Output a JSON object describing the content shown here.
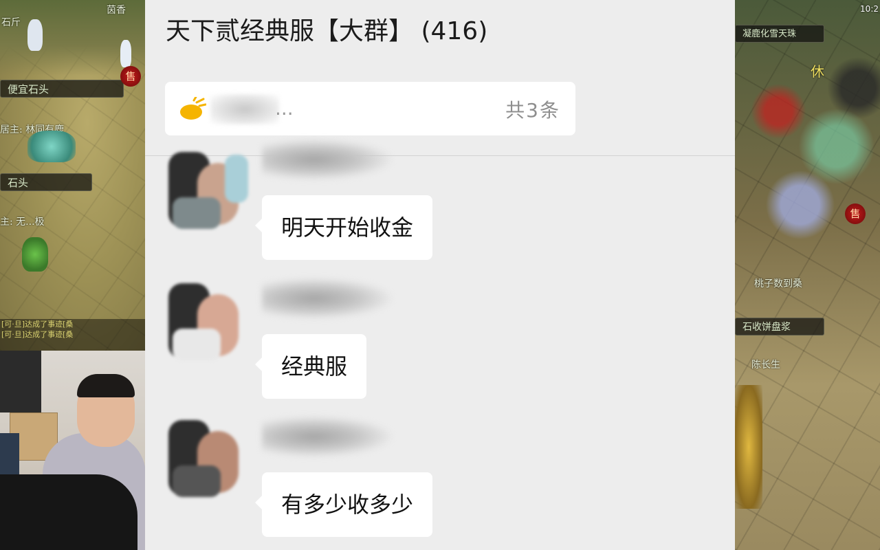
{
  "chat": {
    "title": "天下贰经典服【大群】 (416)",
    "notice": {
      "icon": "megaphone-icon",
      "text": "...",
      "count": "共3条"
    },
    "messages": [
      {
        "text": "明天开始收金"
      },
      {
        "text": "经典服"
      },
      {
        "text": "有多少收多少"
      }
    ]
  },
  "game_left": {
    "labels": [
      "茵香",
      "石斤",
      "便宜石头",
      "居主: 林同有鹿",
      "石头",
      "主: 无...极"
    ],
    "sell_badge": "售",
    "chat_lines": [
      "[可·旦]达成了事迹[桑",
      "[可·旦]达成了事迹[桑"
    ]
  },
  "game_right": {
    "labels": [
      "凝鹿化雪天珠",
      "休",
      "桃子数到桑",
      "石收饼盘浆",
      "陈长生"
    ],
    "sell_badge": "售",
    "clock": "10:2"
  },
  "colors": {
    "panel_bg": "#ededed",
    "bubble_bg": "#ffffff",
    "accent_icon": "#f5b400"
  }
}
